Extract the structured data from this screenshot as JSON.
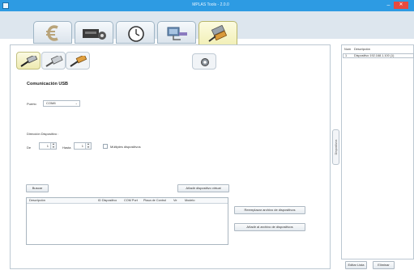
{
  "window": {
    "title": "MPLAS Tools - 2.0.0",
    "min_glyph": "–",
    "close_glyph": "✕"
  },
  "main_tabs": [
    {
      "name": "currency",
      "icon": "euro-icon"
    },
    {
      "name": "money-device",
      "icon": "cash-device-icon"
    },
    {
      "name": "clock",
      "icon": "clock-icon"
    },
    {
      "name": "network",
      "icon": "network-icon"
    },
    {
      "name": "cables",
      "icon": "cable-icon",
      "active": true
    }
  ],
  "sub_tabs": [
    {
      "name": "usb",
      "icon": "usb-cable-icon",
      "active": true
    },
    {
      "name": "serial",
      "icon": "serial-cable-icon"
    },
    {
      "name": "ethernet",
      "icon": "ethernet-cable-icon"
    }
  ],
  "usb": {
    "title": "Comunicación USB",
    "port_label": "Puerto",
    "port_value": "COM8"
  },
  "address": {
    "title": "Dirección Dispositivo :",
    "from_label": "De",
    "from_value": "1",
    "to_label": "Hasta",
    "to_value": "1",
    "multi_label": "Múltiples dispositivos"
  },
  "buttons": {
    "search": "Buscar",
    "add_virtual": "Añadir dispositivo virtual",
    "replace_file": "Reemplazar archivo de dispositivos",
    "add_to_file": "Añadir al archivo de dispositivos",
    "edit_list": "Editar Lista",
    "delete": "Eliminar"
  },
  "grid": {
    "columns": [
      "Descripción",
      "ID Dispositivo",
      "COM Port",
      "Placa de Control",
      "Ve",
      "Modelo"
    ]
  },
  "dock": {
    "label": "Dispositivos"
  },
  "device_list": {
    "columns": [
      "Num",
      "Descripción"
    ],
    "rows": [
      {
        "num": "1",
        "desc": "Dispositivo 192.168.1.100 (1)"
      }
    ]
  },
  "colors": {
    "titlebar": "#2d9be3",
    "active_tab": "#f2f0b8",
    "close": "#e64a3f"
  }
}
